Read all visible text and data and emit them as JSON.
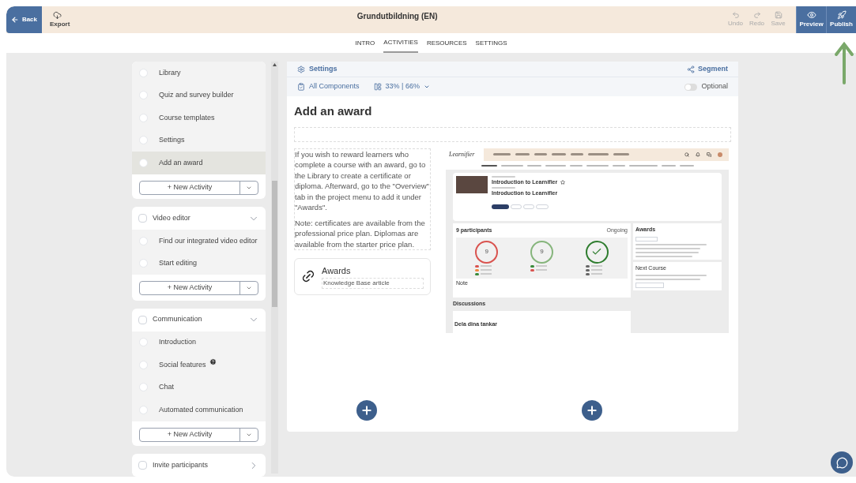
{
  "header": {
    "back": "Back",
    "export": "Export",
    "title": "Grundutbildning (EN)",
    "actions": [
      {
        "label": "Undo",
        "kind": "undo",
        "disabled": true
      },
      {
        "label": "Redo",
        "kind": "redo",
        "disabled": true
      },
      {
        "label": "Save",
        "kind": "save",
        "disabled": true
      }
    ],
    "primary": [
      {
        "label": "Preview",
        "kind": "preview"
      },
      {
        "label": "Publish",
        "kind": "publish"
      }
    ]
  },
  "tabs": [
    {
      "label": "INTRO",
      "selected": false
    },
    {
      "label": "ACTIVITIES",
      "selected": true
    },
    {
      "label": "RESOURCES",
      "selected": false
    },
    {
      "label": "SETTINGS",
      "selected": false
    }
  ],
  "sidebar": {
    "groups": [
      {
        "items": [
          {
            "label": "Library",
            "selected": false
          },
          {
            "label": "Quiz and survey builder",
            "selected": false
          },
          {
            "label": "Course templates",
            "selected": false
          },
          {
            "label": "Settings",
            "selected": false
          },
          {
            "label": "Add an award",
            "selected": true
          }
        ],
        "button": "+ New Activity"
      },
      {
        "title": "Video editor",
        "expanded": true,
        "items": [
          {
            "label": "Find our integrated video editor",
            "selected": false
          },
          {
            "label": "Start editing",
            "selected": false
          }
        ],
        "button": "+ New Activity"
      },
      {
        "title": "Communication",
        "expanded": true,
        "items": [
          {
            "label": "Introduction",
            "selected": false
          },
          {
            "label": "Social features",
            "selected": false,
            "help": true
          },
          {
            "label": "Chat",
            "selected": false
          },
          {
            "label": "Automated communication",
            "selected": false
          }
        ],
        "button": "+ New Activity"
      },
      {
        "title": "Invite participants",
        "expanded": false
      }
    ]
  },
  "editor": {
    "settings": "Settings",
    "segment": "Segment",
    "components": "All Components",
    "layout": "33% | 66%",
    "optional": {
      "label": "Optional",
      "on": false
    },
    "title": "Add an award",
    "paragraphs": [
      "If you wish to reward learners who complete a course with an award, go to the Library to create a certificate or diploma. Afterward, go to the \"Overview\" tab in the project menu to add it under \"Awards\".",
      "Note: certificates are available from the professional price plan. Diplomas are available from the starter price plan."
    ],
    "link": {
      "title": "Awards",
      "subtitle": "Knowledge Base article"
    },
    "screenshot": {
      "logo": "Learnifier",
      "project_title": "Introduction to Learnifier",
      "course_title": "Introduction to Learnifier",
      "participants": "9 participants",
      "status": "Ongoing",
      "rings": [
        {
          "kind": "number",
          "value": "9",
          "legend": [
            {
              "color": "#d9534f"
            },
            {
              "color": "#f0883e"
            },
            {
              "color": "#3a8a3a"
            }
          ]
        },
        {
          "kind": "number",
          "value": "9",
          "legend": [
            {
              "color": "#3a8a3a"
            },
            {
              "color": "#d9534f"
            }
          ]
        },
        {
          "kind": "check",
          "legend": [
            {
              "color": "#666666"
            },
            {
              "color": "#666666"
            },
            {
              "color": "#666666"
            }
          ]
        }
      ],
      "note": "Note",
      "discussions": "Discussions",
      "discussion_title": "Dela dina tankar",
      "awards": "Awards",
      "next": "Next Course"
    }
  }
}
